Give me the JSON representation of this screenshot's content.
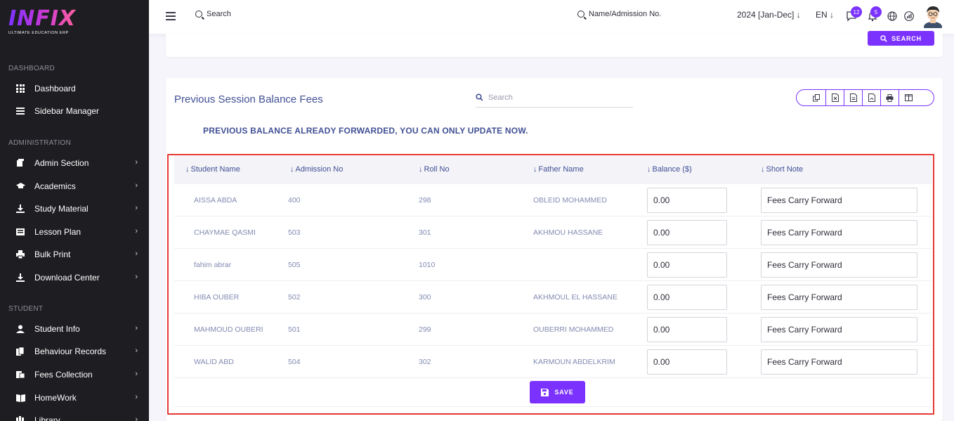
{
  "brand": {
    "logo": "INFIX",
    "tagline": "ULTIMATE EDUCATION ERP"
  },
  "sidebar": {
    "sections": [
      {
        "label": "DASHBOARD",
        "items": [
          {
            "label": "Dashboard",
            "icon": "grid-icon",
            "chevron": false
          },
          {
            "label": "Sidebar Manager",
            "icon": "list-icon",
            "chevron": false
          }
        ]
      },
      {
        "label": "ADMINISTRATION",
        "items": [
          {
            "label": "Admin Section",
            "icon": "admin-icon",
            "chevron": true
          },
          {
            "label": "Academics",
            "icon": "graduation-cap-icon",
            "chevron": true
          },
          {
            "label": "Study Material",
            "icon": "download-icon",
            "chevron": true
          },
          {
            "label": "Lesson Plan",
            "icon": "lesson-icon",
            "chevron": true
          },
          {
            "label": "Bulk Print",
            "icon": "printer-icon",
            "chevron": true
          },
          {
            "label": "Download Center",
            "icon": "download-icon",
            "chevron": true
          }
        ]
      },
      {
        "label": "STUDENT",
        "items": [
          {
            "label": "Student Info",
            "icon": "user-icon",
            "chevron": true
          },
          {
            "label": "Behaviour Records",
            "icon": "records-icon",
            "chevron": true
          },
          {
            "label": "Fees Collection",
            "icon": "fees-icon",
            "chevron": true
          },
          {
            "label": "HomeWork",
            "icon": "book-icon",
            "chevron": true
          },
          {
            "label": "Library",
            "icon": "library-icon",
            "chevron": true
          }
        ]
      }
    ]
  },
  "topbar": {
    "search_label": "Search",
    "student_search_label": "Name/Admission No.",
    "session": "2024 [Jan-Dec]",
    "language": "EN",
    "message_count": "12",
    "notification_count": "5"
  },
  "filter": {
    "search_button": "SEARCH"
  },
  "panel": {
    "title": "Previous Session Balance Fees",
    "search_placeholder": "Search",
    "notice": "PREVIOUS BALANCE ALREADY FORWARDED, YOU CAN ONLY UPDATE NOW.",
    "columns": [
      "Student Name",
      "Admission No",
      "Roll No",
      "Father Name",
      "Balance ($)",
      "Short Note"
    ],
    "rows": [
      {
        "name": "AISSA ABDA",
        "admission": "400",
        "roll": "298",
        "father": "OBLEID MOHAMMED",
        "balance": "0.00",
        "note": "Fees Carry Forward"
      },
      {
        "name": "CHAYMAE QASMI",
        "admission": "503",
        "roll": "301",
        "father": "AKHMOU HASSANE",
        "balance": "0.00",
        "note": "Fees Carry Forward"
      },
      {
        "name": "fahim abrar",
        "admission": "505",
        "roll": "1010",
        "father": "",
        "balance": "0.00",
        "note": "Fees Carry Forward"
      },
      {
        "name": "HIBA OUBER",
        "admission": "502",
        "roll": "300",
        "father": "AKHMOUL EL HASSANE",
        "balance": "0.00",
        "note": "Fees Carry Forward"
      },
      {
        "name": "MAHMOUD OUBERI",
        "admission": "501",
        "roll": "299",
        "father": "OUBERRI MOHAMMED",
        "balance": "0.00",
        "note": "Fees Carry Forward"
      },
      {
        "name": "WALID ABD",
        "admission": "504",
        "roll": "302",
        "father": "KARMOUN ABDELKRIM",
        "balance": "0.00",
        "note": "Fees Carry Forward"
      }
    ],
    "save_button": "SAVE"
  },
  "colors": {
    "accent": "#7c32ff",
    "text": "#415094",
    "highlight": "#e53935",
    "sidebar_bg": "#1e1e22"
  }
}
